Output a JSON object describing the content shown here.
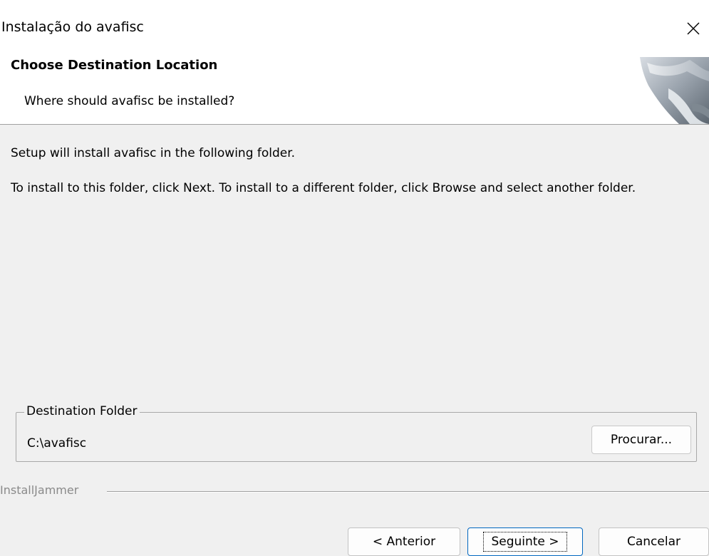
{
  "window": {
    "title": "Instalação do avafisc",
    "close_glyph": "✕"
  },
  "header": {
    "title": "Choose Destination Location",
    "subtitle": "Where should avafisc be installed?",
    "graphic_icon": "installer-logo-icon"
  },
  "body": {
    "line1": "Setup will install avafisc in the following folder.",
    "line2": "To install to this folder, click Next.  To install to a different folder, click Browse and select another folder."
  },
  "destination": {
    "group_label": "Destination Folder",
    "path": "C:\\avafisc",
    "browse_label": "Procurar..."
  },
  "footer": {
    "brand": "InstallJammer",
    "back_label": "< Anterior",
    "next_label": "Seguinte >",
    "cancel_label": "Cancelar"
  },
  "colors": {
    "window_bg": "#f0f0f0",
    "header_bg": "#ffffff",
    "focus_border": "#0067c0"
  }
}
